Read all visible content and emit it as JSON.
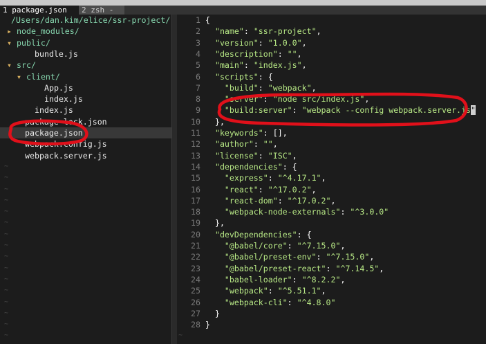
{
  "tabs": [
    {
      "label": "1 package.json"
    },
    {
      "label": "2 zsh -"
    }
  ],
  "tree": {
    "path": "/Users/dan.kim/elice/ssr-project/",
    "items": [
      {
        "arrow": "▸",
        "label": "node_modules/",
        "type": "dir",
        "indent": 0
      },
      {
        "arrow": "▾",
        "label": "public/",
        "type": "dir",
        "indent": 0
      },
      {
        "arrow": "",
        "label": "bundle.js",
        "type": "file",
        "indent": 1
      },
      {
        "arrow": "▾",
        "label": "src/",
        "type": "dir",
        "indent": 0
      },
      {
        "arrow": "▾",
        "label": "client/",
        "type": "dir",
        "indent": 1
      },
      {
        "arrow": "",
        "label": "App.js",
        "type": "file",
        "indent": 2
      },
      {
        "arrow": "",
        "label": "index.js",
        "type": "file",
        "indent": 2
      },
      {
        "arrow": "",
        "label": "index.js",
        "type": "file",
        "indent": 1
      },
      {
        "arrow": "",
        "label": "package-lock.json",
        "type": "file",
        "indent": 0
      },
      {
        "arrow": "",
        "label": "package.json",
        "type": "file",
        "indent": 0,
        "selected": true
      },
      {
        "arrow": "",
        "label": "webpack.config.js",
        "type": "file",
        "indent": 0
      },
      {
        "arrow": "",
        "label": "webpack.server.js",
        "type": "file",
        "indent": 0
      }
    ],
    "tilde": "~"
  },
  "editor": {
    "lines": [
      {
        "n": "1",
        "parts": [
          [
            "p",
            "{"
          ]
        ]
      },
      {
        "n": "2",
        "parts": [
          [
            "p",
            "  "
          ],
          [
            "k",
            "\"name\""
          ],
          [
            "p",
            ": "
          ],
          [
            "s",
            "\"ssr-project\""
          ],
          [
            "p",
            ","
          ]
        ]
      },
      {
        "n": "3",
        "parts": [
          [
            "p",
            "  "
          ],
          [
            "k",
            "\"version\""
          ],
          [
            "p",
            ": "
          ],
          [
            "s",
            "\"1.0.0\""
          ],
          [
            "p",
            ","
          ]
        ]
      },
      {
        "n": "4",
        "parts": [
          [
            "p",
            "  "
          ],
          [
            "k",
            "\"description\""
          ],
          [
            "p",
            ": "
          ],
          [
            "s",
            "\"\""
          ],
          [
            "p",
            ","
          ]
        ]
      },
      {
        "n": "5",
        "parts": [
          [
            "p",
            "  "
          ],
          [
            "k",
            "\"main\""
          ],
          [
            "p",
            ": "
          ],
          [
            "s",
            "\"index.js\""
          ],
          [
            "p",
            ","
          ]
        ]
      },
      {
        "n": "6",
        "parts": [
          [
            "p",
            "  "
          ],
          [
            "k",
            "\"scripts\""
          ],
          [
            "p",
            ": {"
          ]
        ]
      },
      {
        "n": "7",
        "parts": [
          [
            "p",
            "    "
          ],
          [
            "k",
            "\"build\""
          ],
          [
            "p",
            ": "
          ],
          [
            "s",
            "\"webpack\""
          ],
          [
            "p",
            ","
          ]
        ]
      },
      {
        "n": "8",
        "parts": [
          [
            "p",
            "    "
          ],
          [
            "k",
            "\"server\""
          ],
          [
            "p",
            ": "
          ],
          [
            "s",
            "\"node src/index.js\""
          ],
          [
            "p",
            ","
          ]
        ]
      },
      {
        "n": "9",
        "parts": [
          [
            "p",
            "    "
          ],
          [
            "k",
            "\"build:server\""
          ],
          [
            "p",
            ": "
          ],
          [
            "s",
            "\"webpack --config webpack.server.js"
          ],
          [
            "c",
            "\""
          ]
        ]
      },
      {
        "n": "10",
        "parts": [
          [
            "p",
            "  },"
          ]
        ]
      },
      {
        "n": "11",
        "parts": [
          [
            "p",
            "  "
          ],
          [
            "k",
            "\"keywords\""
          ],
          [
            "p",
            ": [],"
          ]
        ]
      },
      {
        "n": "12",
        "parts": [
          [
            "p",
            "  "
          ],
          [
            "k",
            "\"author\""
          ],
          [
            "p",
            ": "
          ],
          [
            "s",
            "\"\""
          ],
          [
            "p",
            ","
          ]
        ]
      },
      {
        "n": "13",
        "parts": [
          [
            "p",
            "  "
          ],
          [
            "k",
            "\"license\""
          ],
          [
            "p",
            ": "
          ],
          [
            "s",
            "\"ISC\""
          ],
          [
            "p",
            ","
          ]
        ]
      },
      {
        "n": "14",
        "parts": [
          [
            "p",
            "  "
          ],
          [
            "k",
            "\"dependencies\""
          ],
          [
            "p",
            ": {"
          ]
        ]
      },
      {
        "n": "15",
        "parts": [
          [
            "p",
            "    "
          ],
          [
            "k",
            "\"express\""
          ],
          [
            "p",
            ": "
          ],
          [
            "s",
            "\"^4.17.1\""
          ],
          [
            "p",
            ","
          ]
        ]
      },
      {
        "n": "16",
        "parts": [
          [
            "p",
            "    "
          ],
          [
            "k",
            "\"react\""
          ],
          [
            "p",
            ": "
          ],
          [
            "s",
            "\"^17.0.2\""
          ],
          [
            "p",
            ","
          ]
        ]
      },
      {
        "n": "17",
        "parts": [
          [
            "p",
            "    "
          ],
          [
            "k",
            "\"react-dom\""
          ],
          [
            "p",
            ": "
          ],
          [
            "s",
            "\"^17.0.2\""
          ],
          [
            "p",
            ","
          ]
        ]
      },
      {
        "n": "18",
        "parts": [
          [
            "p",
            "    "
          ],
          [
            "k",
            "\"webpack-node-externals\""
          ],
          [
            "p",
            ": "
          ],
          [
            "s",
            "\"^3.0.0\""
          ]
        ]
      },
      {
        "n": "19",
        "parts": [
          [
            "p",
            "  },"
          ]
        ]
      },
      {
        "n": "20",
        "parts": [
          [
            "p",
            "  "
          ],
          [
            "k",
            "\"devDependencies\""
          ],
          [
            "p",
            ": {"
          ]
        ]
      },
      {
        "n": "21",
        "parts": [
          [
            "p",
            "    "
          ],
          [
            "k",
            "\"@babel/core\""
          ],
          [
            "p",
            ": "
          ],
          [
            "s",
            "\"^7.15.0\""
          ],
          [
            "p",
            ","
          ]
        ]
      },
      {
        "n": "22",
        "parts": [
          [
            "p",
            "    "
          ],
          [
            "k",
            "\"@babel/preset-env\""
          ],
          [
            "p",
            ": "
          ],
          [
            "s",
            "\"^7.15.0\""
          ],
          [
            "p",
            ","
          ]
        ]
      },
      {
        "n": "23",
        "parts": [
          [
            "p",
            "    "
          ],
          [
            "k",
            "\"@babel/preset-react\""
          ],
          [
            "p",
            ": "
          ],
          [
            "s",
            "\"^7.14.5\""
          ],
          [
            "p",
            ","
          ]
        ]
      },
      {
        "n": "24",
        "parts": [
          [
            "p",
            "    "
          ],
          [
            "k",
            "\"babel-loader\""
          ],
          [
            "p",
            ": "
          ],
          [
            "s",
            "\"^8.2.2\""
          ],
          [
            "p",
            ","
          ]
        ]
      },
      {
        "n": "25",
        "parts": [
          [
            "p",
            "    "
          ],
          [
            "k",
            "\"webpack\""
          ],
          [
            "p",
            ": "
          ],
          [
            "s",
            "\"^5.51.1\""
          ],
          [
            "p",
            ","
          ]
        ]
      },
      {
        "n": "26",
        "parts": [
          [
            "p",
            "    "
          ],
          [
            "k",
            "\"webpack-cli\""
          ],
          [
            "p",
            ": "
          ],
          [
            "s",
            "\"^4.8.0\""
          ]
        ]
      },
      {
        "n": "27",
        "parts": [
          [
            "p",
            "  }"
          ]
        ]
      },
      {
        "n": "28",
        "parts": [
          [
            "p",
            "}"
          ]
        ]
      }
    ],
    "tilde": "~"
  },
  "colors": {
    "annotation": "#e0101a",
    "directory": "#87d7af",
    "string": "#b8e986",
    "line_number": "#7a7a7a",
    "background": "#1c1c1c"
  }
}
